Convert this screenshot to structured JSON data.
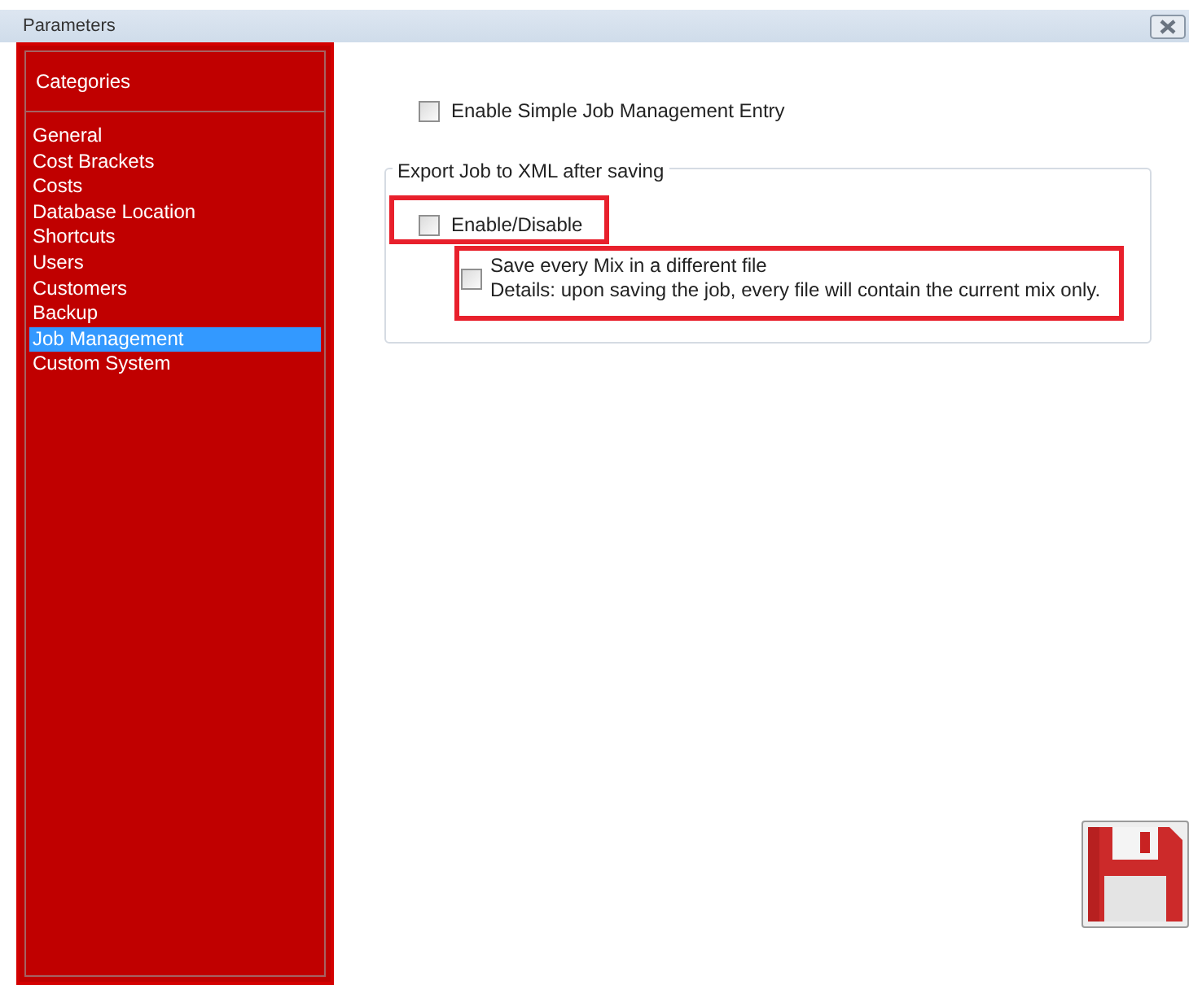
{
  "window": {
    "title": "Parameters"
  },
  "sidebar": {
    "header": "Categories",
    "items": [
      {
        "label": "General",
        "selected": false
      },
      {
        "label": "Cost Brackets",
        "selected": false
      },
      {
        "label": "Costs",
        "selected": false
      },
      {
        "label": "Database Location",
        "selected": false
      },
      {
        "label": "Shortcuts",
        "selected": false
      },
      {
        "label": "Users",
        "selected": false
      },
      {
        "label": "Customers",
        "selected": false
      },
      {
        "label": "Backup",
        "selected": false
      },
      {
        "label": "Job Management",
        "selected": true
      },
      {
        "label": "Custom System",
        "selected": false
      }
    ]
  },
  "simple_entry": {
    "label": "Enable Simple Job Management Entry",
    "checked": false
  },
  "export_group": {
    "title": "Export Job to XML after saving",
    "enable": {
      "label": "Enable/Disable",
      "checked": false,
      "highlighted": true
    },
    "save_every_mix": {
      "label": "Save every Mix in a different file",
      "details": "Details: upon saving the job, every file will contain the current mix only.",
      "checked": false,
      "highlighted": true
    }
  }
}
